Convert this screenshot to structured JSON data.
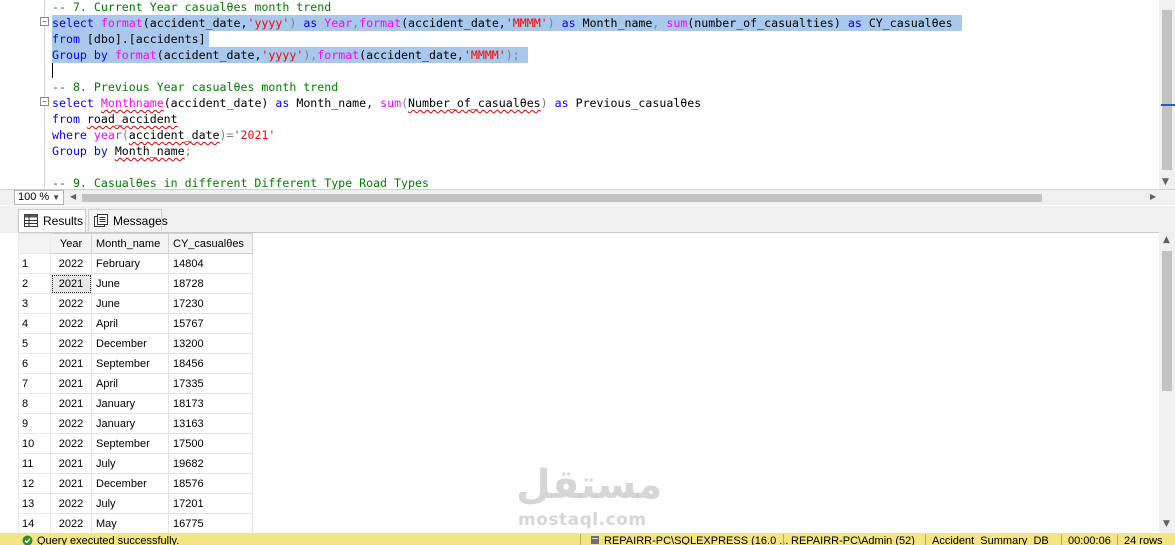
{
  "editor": {
    "lines": [
      {
        "id": "l1",
        "segments": [
          {
            "t": "-- 7. Current Year casualθes month trend",
            "c": "cm"
          }
        ]
      },
      {
        "id": "l2",
        "segments": [
          {
            "t": "select ",
            "c": "kw"
          },
          {
            "t": "format",
            "c": "fn"
          },
          {
            "t": "(accident_date,",
            "c": ""
          },
          {
            "t": "'yyyy'",
            "c": "str"
          },
          {
            "t": ") ",
            "c": "gr"
          },
          {
            "t": "as ",
            "c": "kw"
          },
          {
            "t": "Year",
            "c": "fn"
          },
          {
            "t": ",",
            "c": "gr"
          },
          {
            "t": "format",
            "c": "fn"
          },
          {
            "t": "(accident_date,",
            "c": ""
          },
          {
            "t": "'MMMM'",
            "c": "str"
          },
          {
            "t": ") ",
            "c": "gr"
          },
          {
            "t": "as ",
            "c": "kw"
          },
          {
            "t": "Month_name",
            "c": ""
          },
          {
            "t": ", ",
            "c": "gr"
          },
          {
            "t": "sum",
            "c": "fn"
          },
          {
            "t": "(number_of_casualties) ",
            "c": ""
          },
          {
            "t": "as ",
            "c": "kw"
          },
          {
            "t": "CY_casualθes",
            "c": ""
          }
        ]
      },
      {
        "id": "l3",
        "segments": [
          {
            "t": "from ",
            "c": "kw"
          },
          {
            "t": "[dbo].[accidents]",
            "c": ""
          }
        ]
      },
      {
        "id": "l4",
        "segments": [
          {
            "t": "Group by ",
            "c": "kw"
          },
          {
            "t": "format",
            "c": "fn"
          },
          {
            "t": "(accident_date,",
            "c": ""
          },
          {
            "t": "'yyyy'",
            "c": "str"
          },
          {
            "t": "),",
            "c": "gr"
          },
          {
            "t": "format",
            "c": "fn"
          },
          {
            "t": "(accident_date,",
            "c": ""
          },
          {
            "t": "'MMMM'",
            "c": "str"
          },
          {
            "t": ");",
            "c": "gr"
          }
        ]
      },
      {
        "id": "l5",
        "segments": [
          {
            "t": "",
            "c": ""
          }
        ]
      },
      {
        "id": "l6",
        "segments": [
          {
            "t": "-- 8. Previous Year casualθes month trend",
            "c": "cm"
          }
        ]
      },
      {
        "id": "l7",
        "segments": [
          {
            "t": "select ",
            "c": "kw"
          },
          {
            "t": "Monthname",
            "c": "fn sq"
          },
          {
            "t": "(accident_date) ",
            "c": ""
          },
          {
            "t": "as ",
            "c": "kw"
          },
          {
            "t": "Month_name, ",
            "c": ""
          },
          {
            "t": "sum",
            "c": "fn"
          },
          {
            "t": "(",
            "c": "gr"
          },
          {
            "t": "Number_of_casualθes",
            "c": "sq"
          },
          {
            "t": ") ",
            "c": "gr"
          },
          {
            "t": "as ",
            "c": "kw"
          },
          {
            "t": "Previous_casualθes",
            "c": ""
          }
        ]
      },
      {
        "id": "l8",
        "segments": [
          {
            "t": "from ",
            "c": "kw"
          },
          {
            "t": "road_accident",
            "c": "sq"
          }
        ]
      },
      {
        "id": "l9",
        "segments": [
          {
            "t": "where ",
            "c": "kw"
          },
          {
            "t": "year",
            "c": "fn"
          },
          {
            "t": "(",
            "c": "gr"
          },
          {
            "t": "accident_date",
            "c": "sq"
          },
          {
            "t": ")=",
            "c": "gr"
          },
          {
            "t": "'2021'",
            "c": "str"
          }
        ]
      },
      {
        "id": "l10",
        "segments": [
          {
            "t": "Group by ",
            "c": "kw"
          },
          {
            "t": "Month_name",
            "c": "sq"
          },
          {
            "t": ";",
            "c": "gr"
          }
        ]
      },
      {
        "id": "l11",
        "segments": [
          {
            "t": "",
            "c": ""
          }
        ]
      },
      {
        "id": "l12",
        "segments": [
          {
            "t": "-- 9. Casualθes in different Different Type Road Types",
            "c": "cm"
          }
        ]
      }
    ]
  },
  "zoom": {
    "value": "100 %"
  },
  "tabs": {
    "results": "Results",
    "messages": "Messages"
  },
  "grid": {
    "columns": [
      "Year",
      "Month_name",
      "CY_casualθes"
    ],
    "rows": [
      {
        "n": "1",
        "year": "2022",
        "month": "February",
        "cy": "14804"
      },
      {
        "n": "2",
        "year": "2021",
        "month": "June",
        "cy": "18728"
      },
      {
        "n": "3",
        "year": "2022",
        "month": "June",
        "cy": "17230"
      },
      {
        "n": "4",
        "year": "2022",
        "month": "April",
        "cy": "15767"
      },
      {
        "n": "5",
        "year": "2022",
        "month": "December",
        "cy": "13200"
      },
      {
        "n": "6",
        "year": "2021",
        "month": "September",
        "cy": "18456"
      },
      {
        "n": "7",
        "year": "2021",
        "month": "April",
        "cy": "17335"
      },
      {
        "n": "8",
        "year": "2021",
        "month": "January",
        "cy": "18173"
      },
      {
        "n": "9",
        "year": "2022",
        "month": "January",
        "cy": "13163"
      },
      {
        "n": "10",
        "year": "2022",
        "month": "September",
        "cy": "17500"
      },
      {
        "n": "11",
        "year": "2021",
        "month": "July",
        "cy": "19682"
      },
      {
        "n": "12",
        "year": "2021",
        "month": "December",
        "cy": "18576"
      },
      {
        "n": "13",
        "year": "2022",
        "month": "July",
        "cy": "17201"
      },
      {
        "n": "14",
        "year": "2022",
        "month": "May",
        "cy": "16775"
      }
    ]
  },
  "watermark": {
    "arabic": "مستقل",
    "latin": "mostaql.com"
  },
  "status": {
    "message": "Query executed successfully.",
    "server": "REPAIRR-PC\\SQLEXPRESS (16.0 ...",
    "user": "REPAIRR-PC\\Admin (52)",
    "database": "Accident_Summary_DB",
    "elapsed": "00:00:06",
    "rows": "24 rows"
  },
  "colors": {
    "selection": "#a8c8ec",
    "status_bar": "#f3e582",
    "keyword": "#0000ff",
    "function": "#ff00ff",
    "string": "#ff0000",
    "comment": "#008000"
  }
}
